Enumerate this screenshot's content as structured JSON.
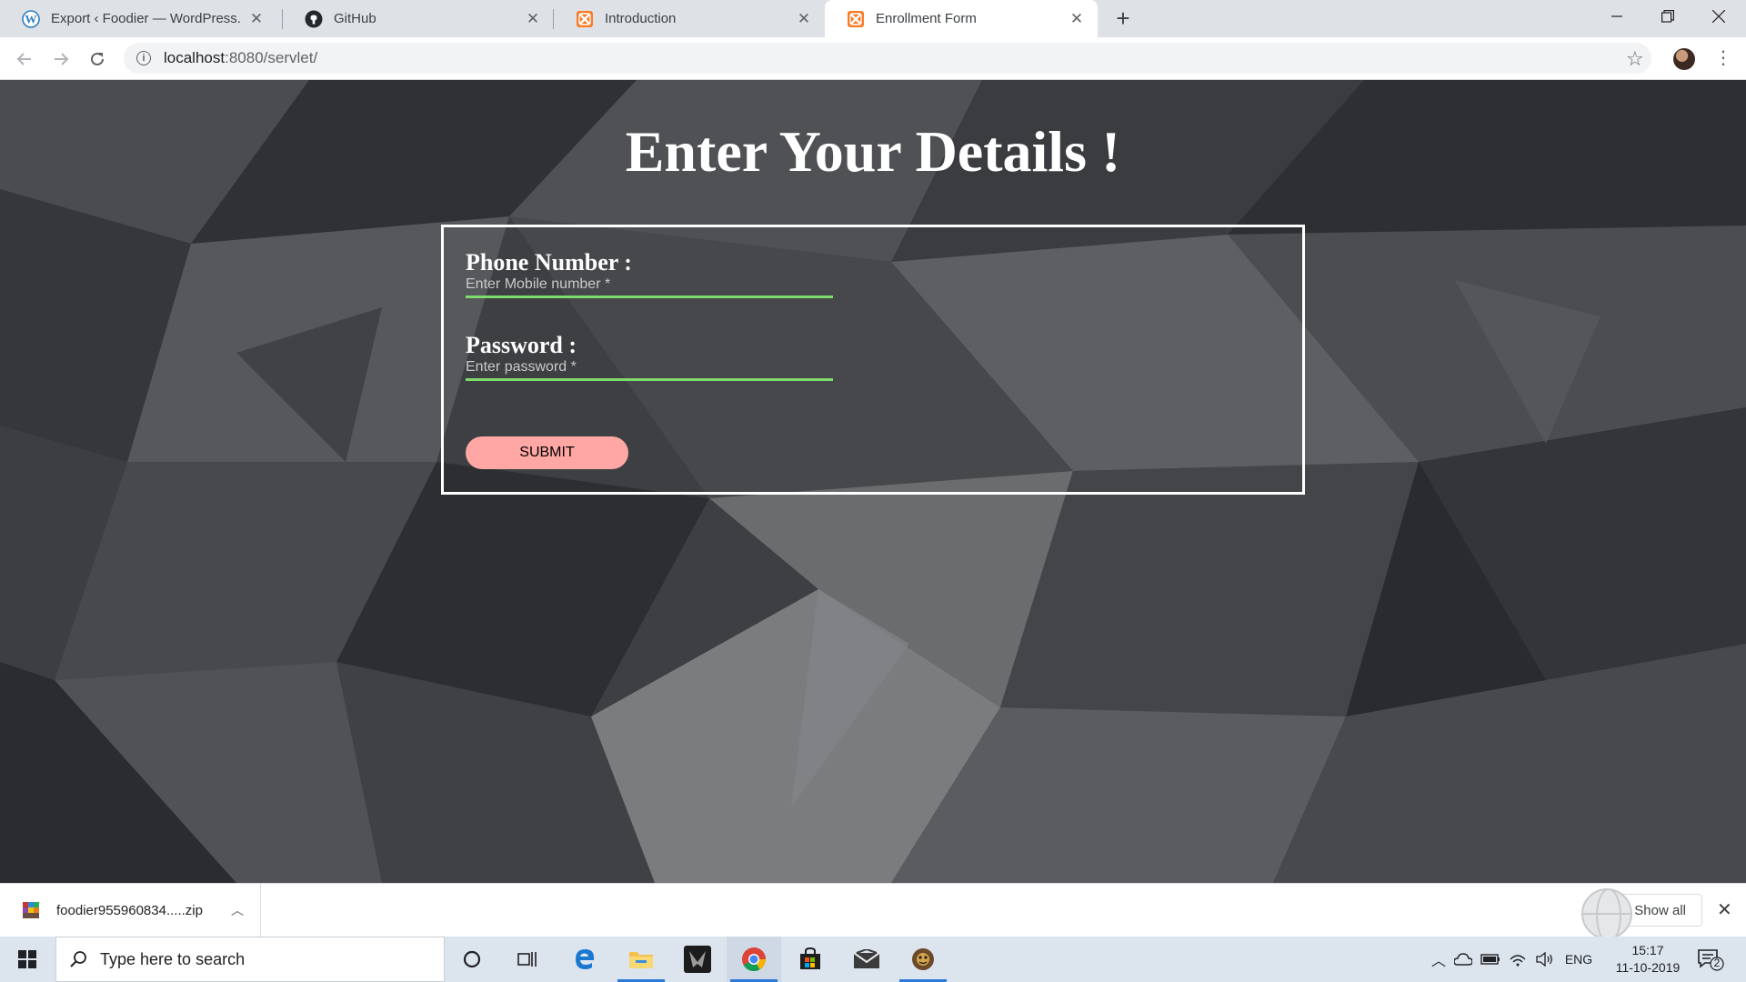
{
  "browser": {
    "tabs": [
      {
        "title": "Export ‹ Foodier — WordPress.com",
        "icon": "wordpress-icon",
        "active": false
      },
      {
        "title": "GitHub",
        "icon": "github-icon",
        "active": false
      },
      {
        "title": "Introduction",
        "icon": "xampp-icon",
        "active": false
      },
      {
        "title": "Enrollment Form",
        "icon": "xampp-icon",
        "active": true
      }
    ],
    "url_host": "localhost",
    "url_rest": ":8080/servlet/"
  },
  "page": {
    "heading": "Enter Your Details !",
    "phone_label": "Phone Number :",
    "phone_placeholder": "Enter Mobile number *",
    "password_label": "Password :",
    "password_placeholder": "Enter password *",
    "submit_label": "SUBMIT",
    "colors": {
      "input_underline": "#7cdc6e",
      "submit_bg": "#ffa7a4",
      "form_border": "#ffffff"
    }
  },
  "downloads": {
    "file_name": "foodier955960834.....zip",
    "show_all_label": "Show all"
  },
  "taskbar": {
    "search_placeholder": "Type here to search",
    "language": "ENG",
    "time": "15:17",
    "date": "11-10-2019",
    "notification_count": "2"
  }
}
